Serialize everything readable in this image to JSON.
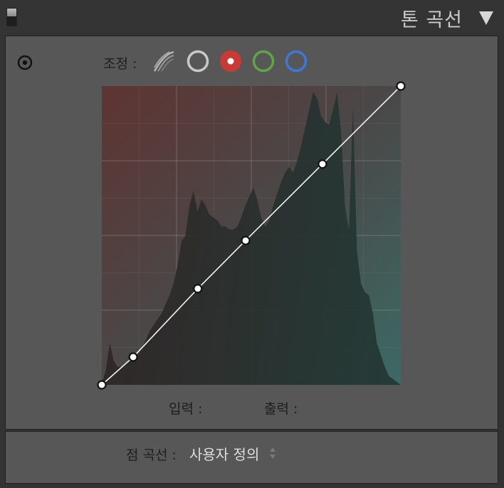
{
  "header": {
    "title": "톤 곡선"
  },
  "controls": {
    "adjust_label": "조정 :",
    "channels": [
      {
        "name": "parametric",
        "icon": "parametric-curve-icon"
      },
      {
        "name": "rgb",
        "color": "#c8c8c8"
      },
      {
        "name": "red",
        "color": "#c93a34",
        "selected": true
      },
      {
        "name": "green",
        "color": "#5fa544"
      },
      {
        "name": "blue",
        "color": "#3e78d8"
      }
    ]
  },
  "curve": {
    "points": [
      {
        "input": 0,
        "output": 0
      },
      {
        "input": 0.105,
        "output": 0.093
      },
      {
        "input": 0.321,
        "output": 0.322
      },
      {
        "input": 0.481,
        "output": 0.483
      },
      {
        "input": 0.738,
        "output": 0.739
      },
      {
        "input": 1,
        "output": 1
      }
    ],
    "histogram": [
      0.0,
      0.05,
      0.14,
      0.08,
      0.06,
      0.06,
      0.07,
      0.08,
      0.09,
      0.1,
      0.12,
      0.15,
      0.18,
      0.2,
      0.22,
      0.24,
      0.27,
      0.3,
      0.34,
      0.4,
      0.48,
      0.5,
      0.6,
      0.65,
      0.58,
      0.62,
      0.6,
      0.57,
      0.56,
      0.55,
      0.53,
      0.53,
      0.52,
      0.52,
      0.53,
      0.56,
      0.6,
      0.63,
      0.66,
      0.62,
      0.56,
      0.53,
      0.55,
      0.6,
      0.64,
      0.68,
      0.71,
      0.73,
      0.71,
      0.75,
      0.8,
      0.86,
      0.92,
      0.98,
      0.96,
      0.9,
      0.88,
      0.87,
      0.92,
      0.98,
      0.85,
      0.6,
      0.52,
      0.93,
      0.45,
      0.34,
      0.31,
      0.3,
      0.24,
      0.14,
      0.1,
      0.06,
      0.03,
      0.02,
      0.01,
      0.0
    ]
  },
  "io": {
    "input_label": "입력 :",
    "output_label": "출력 :"
  },
  "point_curve": {
    "label": "점 곡선 :",
    "value": "사용자 정의"
  }
}
